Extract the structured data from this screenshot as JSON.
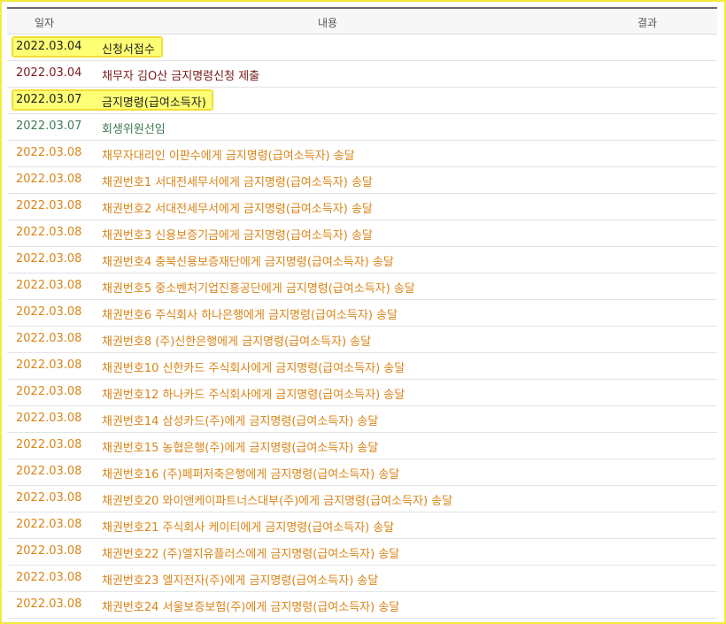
{
  "columns": {
    "date": "일자",
    "content": "내용",
    "result": "결과"
  },
  "rows": [
    {
      "date": "2022.03.04",
      "content": "신청서접수",
      "color": "dark",
      "highlight": true,
      "hlw": 171
    },
    {
      "date": "2022.03.04",
      "content": "채무자 김O산 금지명령신청 제출",
      "color": "dark",
      "highlight": false
    },
    {
      "date": "2022.03.07",
      "content": "금지명령(급여소득자)",
      "color": "dark",
      "highlight": true,
      "hlw": 228
    },
    {
      "date": "2022.03.07",
      "content": "회생위원선임",
      "color": "green",
      "highlight": false
    },
    {
      "date": "2022.03.08",
      "content": "채무자대리인 이판수에게 금지명령(급여소득자) 송달",
      "color": "orange",
      "highlight": false
    },
    {
      "date": "2022.03.08",
      "content": "채권번호1 서대전세무서에게 금지명령(급여소득자) 송달",
      "color": "orange",
      "highlight": false
    },
    {
      "date": "2022.03.08",
      "content": "채권번호2 서대전세무서에게 금지명령(급여소득자) 송달",
      "color": "orange",
      "highlight": false
    },
    {
      "date": "2022.03.08",
      "content": "채권번호3 신용보증기금에게 금지명령(급여소득자) 송달",
      "color": "orange",
      "highlight": false
    },
    {
      "date": "2022.03.08",
      "content": "채권번호4 충북신용보증재단에게 금지명령(급여소득자) 송달",
      "color": "orange",
      "highlight": false
    },
    {
      "date": "2022.03.08",
      "content": "채권번호5 중소벤처기업진흥공단에게 금지명령(급여소득자) 송달",
      "color": "orange",
      "highlight": false
    },
    {
      "date": "2022.03.08",
      "content": "채권번호6 주식회사 하나은행에게 금지명령(급여소득자) 송달",
      "color": "orange",
      "highlight": false
    },
    {
      "date": "2022.03.08",
      "content": "채권번호8 (주)신한은행에게 금지명령(급여소득자) 송달",
      "color": "orange",
      "highlight": false
    },
    {
      "date": "2022.03.08",
      "content": "채권번호10 신한카드 주식회사에게 금지명령(급여소득자) 송달",
      "color": "orange",
      "highlight": false
    },
    {
      "date": "2022.03.08",
      "content": "채권번호12 하나카드 주식회사에게 금지명령(급여소득자) 송달",
      "color": "orange",
      "highlight": false
    },
    {
      "date": "2022.03.08",
      "content": "채권번호14 삼성카드(주)에게 금지명령(급여소득자) 송달",
      "color": "orange",
      "highlight": false
    },
    {
      "date": "2022.03.08",
      "content": "채권번호15 농협은행(주)에게 금지명령(급여소득자) 송달",
      "color": "orange",
      "highlight": false
    },
    {
      "date": "2022.03.08",
      "content": "채권번호16 (주)페퍼저축은행에게 금지명령(급여소득자) 송달",
      "color": "orange",
      "highlight": false
    },
    {
      "date": "2022.03.08",
      "content": "채권번호20 와이앤케이파트너스대부(주)에게 금지명령(급여소득자) 송달",
      "color": "orange",
      "highlight": false
    },
    {
      "date": "2022.03.08",
      "content": "채권번호21 주식회사 케이티에게 금지명령(급여소득자) 송달",
      "color": "orange",
      "highlight": false
    },
    {
      "date": "2022.03.08",
      "content": "채권번호22 (주)엘지유플러스에게 금지명령(급여소득자) 송달",
      "color": "orange",
      "highlight": false
    },
    {
      "date": "2022.03.08",
      "content": "채권번호23 엘지전자(주)에게 금지명령(급여소득자) 송달",
      "color": "orange",
      "highlight": false
    },
    {
      "date": "2022.03.08",
      "content": "채권번호24 서울보증보험(주)에게 금지명령(급여소득자) 송달",
      "color": "orange",
      "highlight": false
    }
  ]
}
